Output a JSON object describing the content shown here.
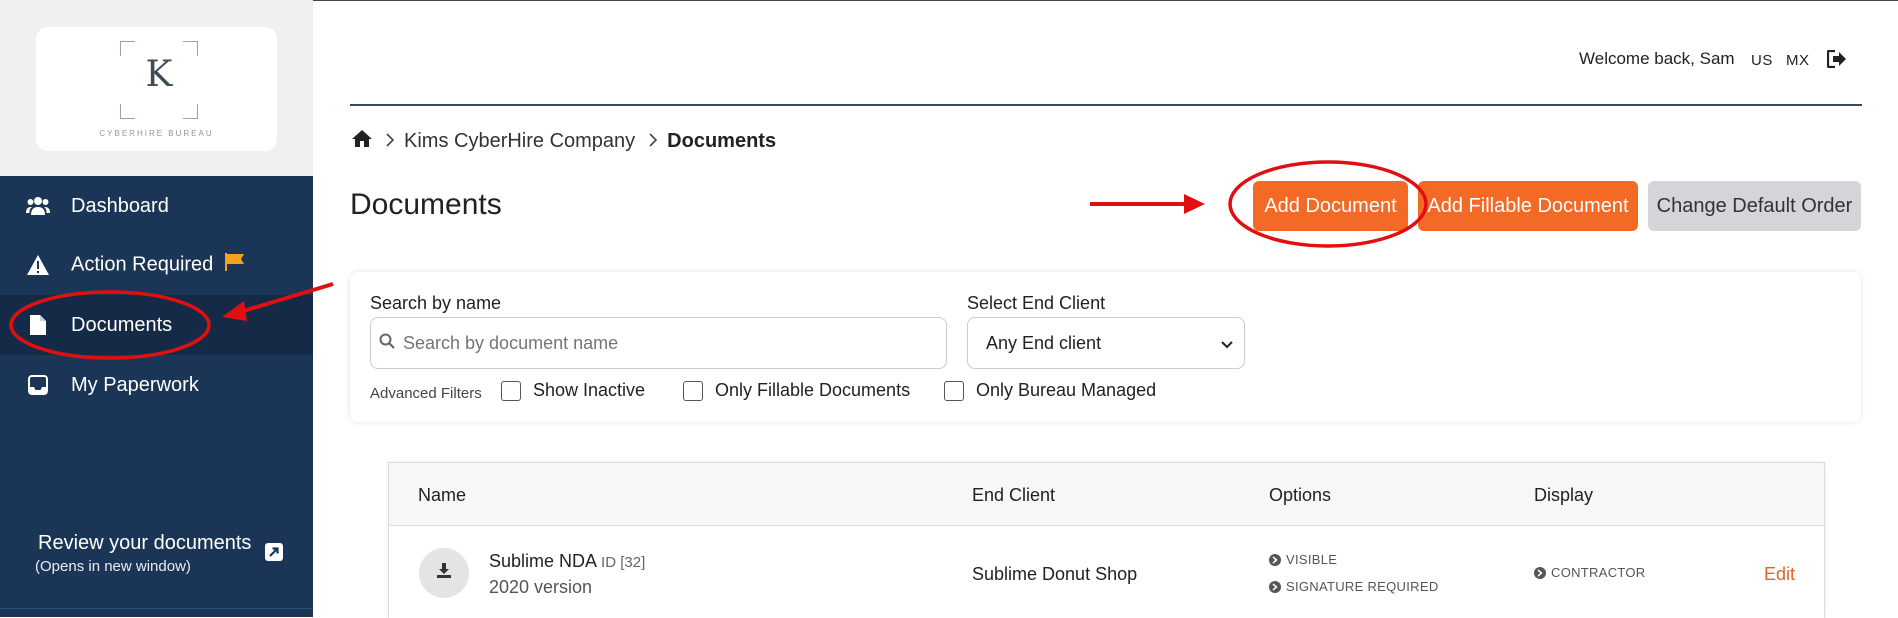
{
  "sidebar": {
    "logo": {
      "letter": "K",
      "subtitle": "CYBERHIRE BUREAU"
    },
    "items": [
      {
        "label": "Dashboard",
        "icon": "users-icon"
      },
      {
        "label": "Action Required",
        "icon": "warning-icon"
      },
      {
        "label": "Documents",
        "icon": "document-icon",
        "active": true
      },
      {
        "label": "My Paperwork",
        "icon": "inbox-icon"
      }
    ],
    "review": {
      "title": "Review your documents",
      "subtitle": "(Opens in new window)",
      "icon": "external-link-icon"
    }
  },
  "header": {
    "welcome": "Welcome back, Sam",
    "lang_us": "US",
    "lang_mx": "MX",
    "logout_icon": "logout-icon"
  },
  "breadcrumb": {
    "home_icon": "home-icon",
    "company": "Kims CyberHire Company",
    "current": "Documents"
  },
  "page": {
    "title": "Documents",
    "add_document": "Add Document",
    "add_fillable": "Add Fillable Document",
    "change_order": "Change Default Order"
  },
  "filters": {
    "search_label": "Search by name",
    "search_placeholder": "Search by document name",
    "client_label": "Select End Client",
    "client_value": "Any End client",
    "advanced": "Advanced Filters",
    "show_inactive": "Show Inactive",
    "only_fillable": "Only Fillable Documents",
    "only_bureau": "Only Bureau Managed"
  },
  "table": {
    "columns": [
      "Name",
      "End Client",
      "Options",
      "Display"
    ],
    "rows": [
      {
        "name": "Sublime NDA",
        "id": "ID [32]",
        "version": "2020 version",
        "client": "Sublime Donut Shop",
        "options": [
          "VISIBLE",
          "SIGNATURE REQUIRED"
        ],
        "display": "CONTRACTOR",
        "edit": "Edit"
      }
    ]
  },
  "colors": {
    "sidebar_bg": "#1b3556",
    "accent_orange": "#f26a25",
    "annotation_red": "#e01010"
  }
}
